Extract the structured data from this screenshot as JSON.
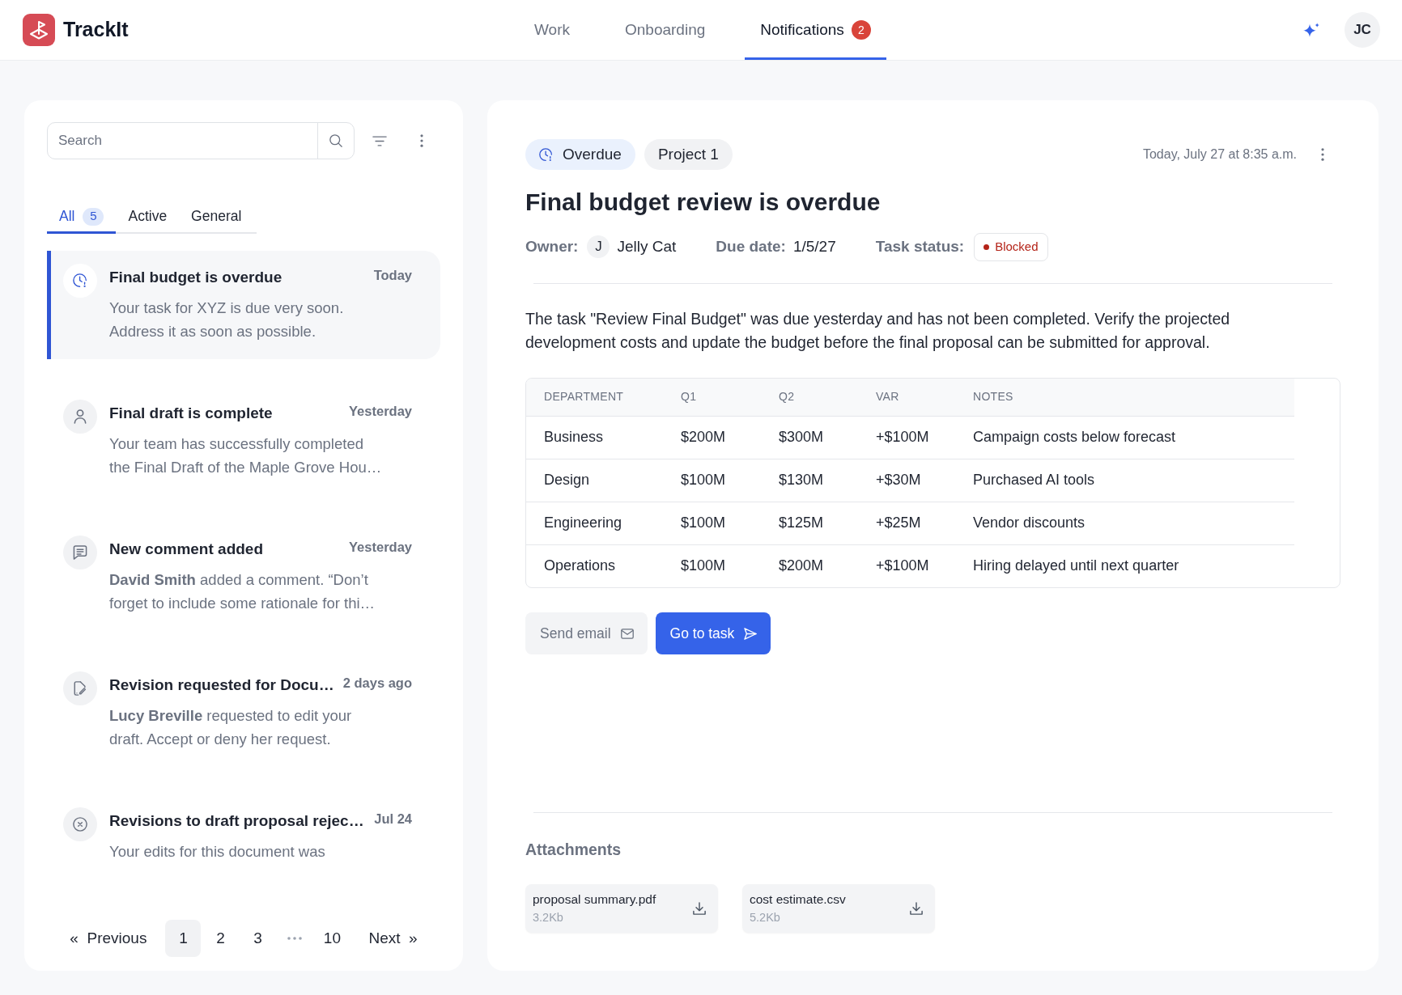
{
  "header": {
    "brand": "TrackIt",
    "nav": [
      {
        "label": "Work",
        "selected": false
      },
      {
        "label": "Onboarding",
        "selected": false
      },
      {
        "label": "Notifications",
        "selected": true,
        "badge": "2"
      }
    ],
    "avatar": "JC"
  },
  "sidebar": {
    "search": {
      "placeholder": "Search"
    },
    "tabs": [
      {
        "label": "All",
        "count": "5",
        "selected": true
      },
      {
        "label": "Active",
        "selected": false
      },
      {
        "label": "General",
        "selected": false
      }
    ],
    "notifications": [
      {
        "kind": "clock",
        "title": "Final budget is overdue",
        "time": "Today",
        "body": "Your task for XYZ is due very soon. Address it as soon as possible.",
        "selected": true
      },
      {
        "kind": "person",
        "title": "Final draft is complete",
        "time": "Yesterday",
        "body": "Your team has successfully completed the Final Draft of the Maple Grove Hou…",
        "selected": false
      },
      {
        "kind": "comment",
        "title": "New comment added",
        "time": "Yesterday",
        "body": "**David Smith** added a comment. “Don’t forget to include some rationale for thi…",
        "selected": false
      },
      {
        "kind": "edit",
        "title": "Revision requested for Docu…",
        "time": "2 days ago",
        "body": "**Lucy Breville** requested to edit your draft. Accept or deny her request.",
        "selected": false
      },
      {
        "kind": "rejected",
        "title": "Revisions to draft proposal rejec…",
        "time": "Jul 24",
        "body": "Your edits for this document was",
        "selected": false
      }
    ],
    "pagination": {
      "previous": {
        "icon": "«",
        "label": "Previous"
      },
      "pages": [
        {
          "kind": "page",
          "label": "1",
          "selected": true
        },
        {
          "kind": "page",
          "label": "2",
          "selected": false
        },
        {
          "kind": "page",
          "label": "3",
          "selected": false
        },
        {
          "kind": "gap"
        },
        {
          "kind": "page",
          "label": "10",
          "selected": false
        }
      ],
      "next": {
        "label": "Next",
        "icon": "»"
      }
    }
  },
  "detail": {
    "tags": [
      {
        "kind": "overdue",
        "label": "Overdue"
      },
      {
        "kind": "project",
        "label": "Project 1"
      }
    ],
    "timestamp": "Today, July 27 at 8:35 a.m.",
    "title": "Final budget review is overdue",
    "owner": {
      "label": "Owner:",
      "initial": "J",
      "name": "Jelly Cat"
    },
    "due_date": {
      "label": "Due date:",
      "value": "1/5/27"
    },
    "task_status": {
      "label": "Task status:",
      "value": "Blocked"
    },
    "description": "The task \"Review Final Budget\" was due yesterday and has not been completed. Verify the projected development costs and update the budget before the final proposal can be submitted for approval.",
    "table": {
      "columns": [
        "DEPARTMENT",
        "Q1",
        "Q2",
        "VAR",
        "NOTES"
      ],
      "rows": [
        [
          "Business",
          "$200M",
          "$300M",
          "+$100M",
          "Campaign costs below forecast"
        ],
        [
          "Design",
          "$100M",
          "$130M",
          "+$30M",
          "Purchased AI tools"
        ],
        [
          "Engineering",
          "$100M",
          "$125M",
          "+$25M",
          "Vendor discounts"
        ],
        [
          "Operations",
          "$100M",
          "$200M",
          "+$100M",
          "Hiring delayed until next quarter"
        ]
      ]
    },
    "actions": [
      {
        "kind": "email",
        "label": "Send email"
      },
      {
        "kind": "open",
        "label": "Go to task"
      }
    ],
    "attachments": {
      "heading": "Attachments",
      "files": [
        {
          "name": "proposal summary.pdf",
          "size": "3.2Kb"
        },
        {
          "name": "cost estimate.csv",
          "size": "5.2Kb"
        }
      ]
    }
  }
}
